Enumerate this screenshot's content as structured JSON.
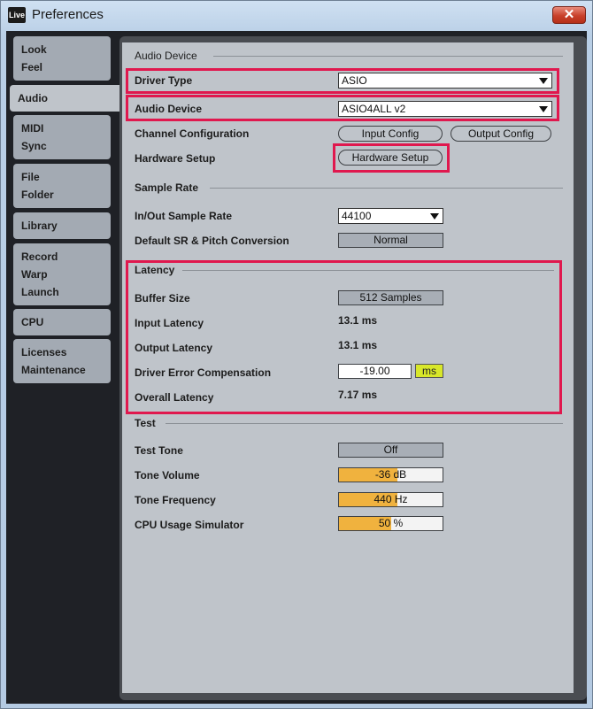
{
  "window": {
    "app_icon_text": "Live",
    "title": "Preferences",
    "close_glyph": "✕"
  },
  "sidebar": {
    "items": [
      {
        "lines": [
          "Look",
          "Feel"
        ]
      },
      {
        "lines": [
          "Audio"
        ],
        "active": true
      },
      {
        "lines": [
          "MIDI",
          "Sync"
        ]
      },
      {
        "lines": [
          "File",
          "Folder"
        ]
      },
      {
        "lines": [
          "Library"
        ]
      },
      {
        "lines": [
          "Record",
          "Warp",
          "Launch"
        ]
      },
      {
        "lines": [
          "CPU"
        ]
      },
      {
        "lines": [
          "Licenses",
          "Maintenance"
        ]
      }
    ]
  },
  "audio_device": {
    "section_title": "Audio Device",
    "driver_type_label": "Driver Type",
    "driver_type_value": "ASIO",
    "audio_device_label": "Audio Device",
    "audio_device_value": "ASIO4ALL v2",
    "channel_config_label": "Channel Configuration",
    "input_config_button": "Input Config",
    "output_config_button": "Output Config",
    "hardware_setup_label": "Hardware Setup",
    "hardware_setup_button": "Hardware Setup"
  },
  "sample_rate": {
    "section_title": "Sample Rate",
    "inout_label": "In/Out Sample Rate",
    "inout_value": "44100",
    "default_sr_label": "Default SR & Pitch Conversion",
    "default_sr_value": "Normal"
  },
  "latency": {
    "section_title": "Latency",
    "buffer_label": "Buffer Size",
    "buffer_value": "512 Samples",
    "input_label": "Input Latency",
    "input_value": "13.1 ms",
    "output_label": "Output Latency",
    "output_value": "13.1 ms",
    "driver_err_label": "Driver Error Compensation",
    "driver_err_value": "-19.00",
    "driver_err_unit": "ms",
    "overall_label": "Overall Latency",
    "overall_value": "7.17 ms"
  },
  "test": {
    "section_title": "Test",
    "tone_label": "Test Tone",
    "tone_value": "Off",
    "volume_label": "Tone Volume",
    "volume_value": "-36 dB",
    "volume_fill": 0.56,
    "freq_label": "Tone Frequency",
    "freq_value": "440 Hz",
    "freq_fill": 0.56,
    "cpu_label": "CPU Usage Simulator",
    "cpu_value": "50 %",
    "cpu_fill": 0.5
  },
  "colors": {
    "highlight": "#e0184e",
    "meter_fill": "#f0b23e",
    "ms_button": "#d8e72a"
  }
}
